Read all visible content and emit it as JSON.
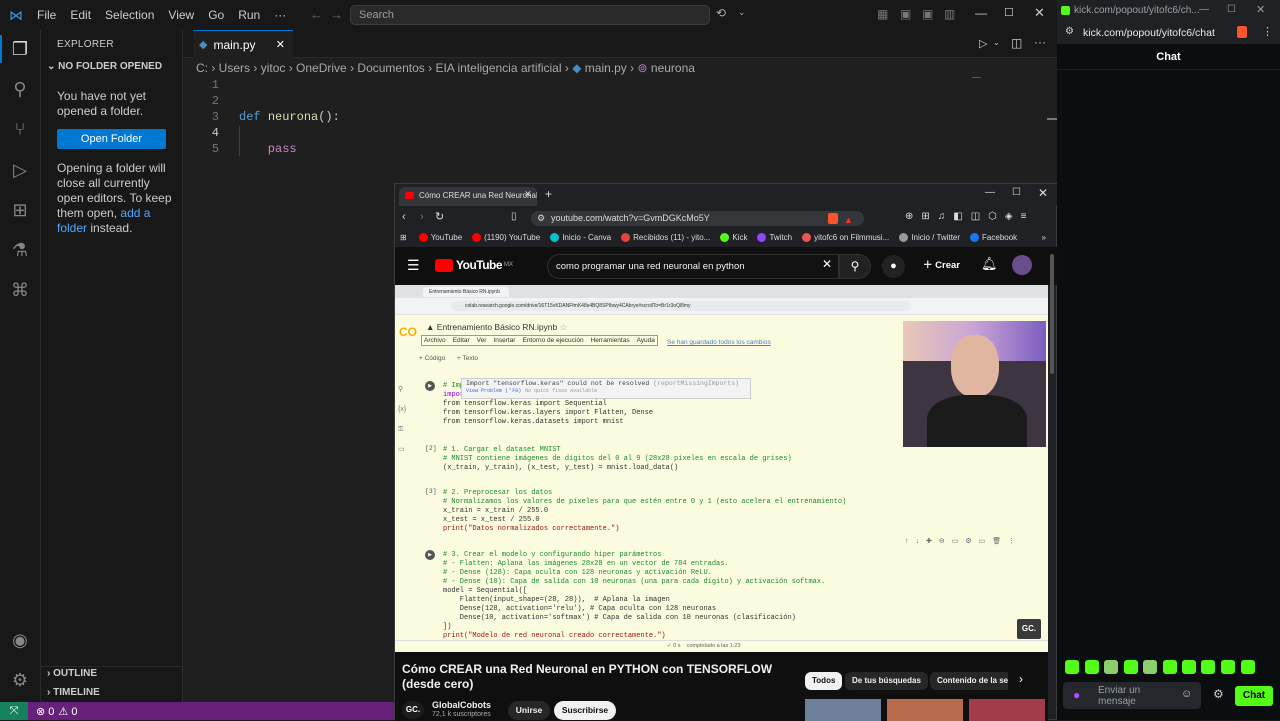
{
  "titlebar": {
    "menu": [
      "File",
      "Edit",
      "Selection",
      "View",
      "Go",
      "Run",
      "···"
    ],
    "search_placeholder": "Search"
  },
  "sidebar": {
    "header": "EXPLORER",
    "section": "NO FOLDER OPENED",
    "no_folder_text": "You have not yet opened a folder.",
    "open_folder_label": "Open Folder",
    "hint_pre": "Opening a folder will close all currently open editors. To keep them open,",
    "hint_link": "add a folder",
    "hint_post": "instead.",
    "outline": "OUTLINE",
    "timeline": "TIMELINE"
  },
  "editor": {
    "tab_label": "main.py",
    "breadcrumb": [
      "C:",
      "Users",
      "yitoc",
      "OneDrive",
      "Documentos",
      "EIA inteligencia artificial",
      "main.py",
      "neurona"
    ],
    "lines": [
      {
        "n": "1",
        "text": ""
      },
      {
        "n": "2",
        "text": ""
      },
      {
        "n": "3",
        "kw": "def ",
        "fn": "neurona",
        "rest": "():"
      },
      {
        "n": "4",
        "text": ""
      },
      {
        "n": "5",
        "text": "    pass"
      }
    ]
  },
  "statusbar": {
    "errors": "0",
    "warnings": "0"
  },
  "yt_window": {
    "tab_title": "Cómo CREAR una Red Neuronal",
    "url": "youtube.com/watch?v=GvmDGKcMo5Y",
    "bookmarks": [
      "YouTube",
      "(1190) YouTube",
      "Inicio - Canva",
      "Recibidos (11) - yito...",
      "Kick",
      "Twitch",
      "yitofc6 on Filmmusi...",
      "Inicio / Twitter",
      "Facebook"
    ],
    "yt_logo": "YouTube",
    "yt_country": "MX",
    "search_value": "como programar una red neuronal en python",
    "create_label": "Crear",
    "colab": {
      "tab": "Entrenamiento Básico RN.ipynb",
      "url": "colab.research.google.com/drive/16T15vKDANFfmK48s4BQ8SPIbwy4CAbrye#scrollTo=Br1r3oQl8my",
      "filename": "Entrenamiento Básico RN.ipynb",
      "menu": [
        "Archivo",
        "Editar",
        "Ver",
        "Insertar",
        "Entorno de ejecución",
        "Herramientas",
        "Ayuda"
      ],
      "saved": "Se han guardado todos los cambios",
      "add_code": "+ Código",
      "add_text": "+ Texto",
      "tooltip": "Import \"tensorflow.keras\" could not be resolved",
      "tooltip_code": "(reportMissingImports)",
      "view_problem": "View Problem (⌃F8)",
      "no_fixes": "No quick fixes available",
      "cell1": [
        "# Imp",
        "impor",
        "from tensorflow.keras import Sequential",
        "from tensorflow.keras.layers import Flatten, Dense",
        "from tensorflow.keras.datasets import mnist"
      ],
      "cell2_idx": "[2]",
      "cell2": [
        "# 1. Cargar el dataset MNIST",
        "# MNIST contiene imágenes de dígitos del 0 al 9 (28x28 píxeles en escala de grises)",
        "(x_train, y_train), (x_test, y_test) = mnist.load_data()"
      ],
      "cell3_idx": "[3]",
      "cell3": [
        "# 2. Preprocesar los datos",
        "# Normalizamos los valores de píxeles para que estén entre 0 y 1 (esto acelera el entrenamiento)",
        "x_train = x_train / 255.0",
        "x_test = x_test / 255.0",
        "print(\"Datos normalizados correctamente.\")"
      ],
      "cell4": [
        "# 3. Crear el modelo y configurando hiper parámetros",
        "# - Flatten: Aplana las imágenes 28x28 en un vector de 784 entradas.",
        "# - Dense (128): Capa oculta con 128 neuronas y activación ReLU.",
        "# - Dense (10): Capa de salida con 10 neuronas (una para cada dígito) y activación softmax.",
        "model = Sequential([",
        "    Flatten(input_shape=(28, 28)),  # Aplana la imagen",
        "    Dense(128, activation='relu'), # Capa oculta con 128 neuronas",
        "    Dense(10, activation='softmax') # Capa de salida con 10 neuronas (clasificación)",
        "])",
        "print(\"Modelo de red neuronal creado correctamente.\")"
      ],
      "footer_time": "0 s",
      "footer_done": "completado a las 1:23",
      "watermark": "GC."
    },
    "video_title": "Cómo CREAR una Red Neuronal en PYTHON con TENSORFLOW (desde cero)",
    "channel": "GlobalCobots",
    "subscribers": "72,1 k suscriptores",
    "join": "Unirse",
    "subscribe": "Suscribirse",
    "chips": [
      "Todos",
      "De tus búsquedas",
      "Contenido de la se"
    ],
    "channel_badge": "GC."
  },
  "kick": {
    "url_top": "kick.com/popout/yitofc6/ch...",
    "url": "kick.com/popout/yitofc6/chat",
    "chat_title": "Chat",
    "input_placeholder": "Enviar un mensaje",
    "chat_button": "Chat"
  },
  "colors": {
    "accent": "#0078d4",
    "status": "#68217a",
    "kick": "#53fc18",
    "yt_red": "#ff0000"
  }
}
